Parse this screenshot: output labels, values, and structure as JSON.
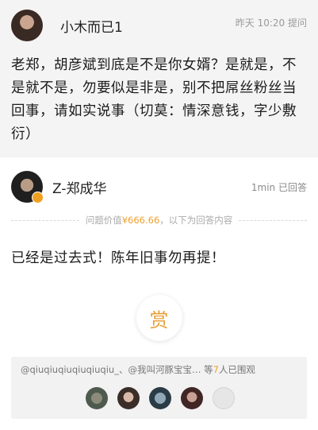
{
  "question": {
    "user_name": "小木而已1",
    "time": "昨天 10:20",
    "action": "提问",
    "text": "老郑，胡彦斌到底是不是你女婿？是就是，不是就不是，勿要似是非是，别不把屌丝粉丝当回事，请如实说事（切莫：情深意钱，字少敷衍）"
  },
  "answer": {
    "user_name": "Z-郑成华",
    "time": "1min",
    "action": "已回答",
    "price_label": "问题价值",
    "price_value": "¥666.66",
    "price_suffix": "，以下为回答内容",
    "text": "已经是过去式！陈年旧事勿再提！",
    "reward_label": "赏"
  },
  "onlookers": {
    "names": "@qiuqiuqiuqiuqiuqiu_、@我叫河豚宝宝…",
    "prefix": "等",
    "count": "7",
    "suffix": "人已围观"
  },
  "colors": {
    "accent": "#f0a030",
    "question_bg": "#f4f4f4"
  }
}
